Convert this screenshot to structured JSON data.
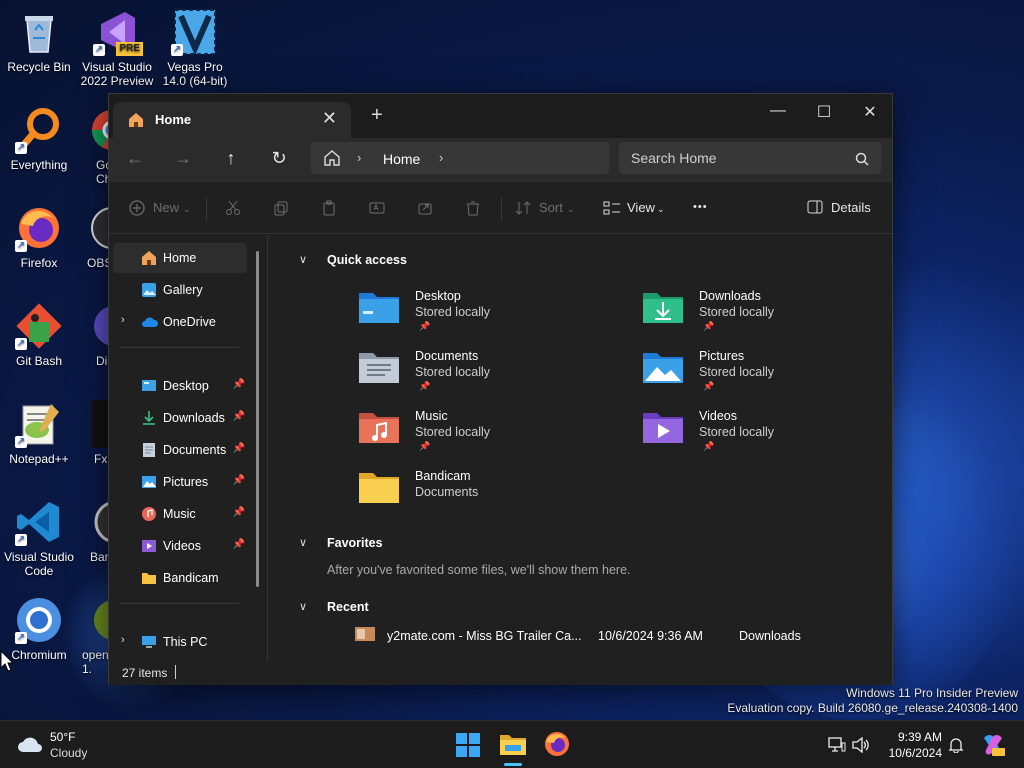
{
  "desktop": {
    "icons": [
      {
        "label": "Recycle Bin"
      },
      {
        "label": "Visual Studio 2022 Preview",
        "badge": "PRE"
      },
      {
        "label": "Vegas Pro 14.0 (64-bit)"
      },
      {
        "label": "Everything"
      },
      {
        "label": "Go Ch"
      },
      {
        "label": "Firefox"
      },
      {
        "label": "OBS"
      },
      {
        "label": "Git Bash"
      },
      {
        "label": "Di"
      },
      {
        "label": "Notepad++"
      },
      {
        "label": "Fx"
      },
      {
        "label": "Visual Studio Code"
      },
      {
        "label": "Ban"
      },
      {
        "label": "Chromium"
      },
      {
        "label": "open 1."
      }
    ]
  },
  "window": {
    "tab_title": "Home",
    "tab_close": "✕",
    "tab_add": "+",
    "minimize": "—",
    "maximize": "☐",
    "close": "✕"
  },
  "nav": {
    "back": "←",
    "forward": "→",
    "up": "↑",
    "refresh": "↻",
    "crumb": "Home",
    "crumb_sep": "›",
    "search_placeholder": "Search Home"
  },
  "toolbar": {
    "new_label": "New",
    "sort_label": "Sort",
    "view_label": "View",
    "more_label": "•••",
    "details_label": "Details"
  },
  "sidebar": {
    "items": [
      {
        "label": "Home"
      },
      {
        "label": "Gallery"
      },
      {
        "label": "OneDrive"
      },
      {
        "label": "Desktop"
      },
      {
        "label": "Downloads"
      },
      {
        "label": "Documents"
      },
      {
        "label": "Pictures"
      },
      {
        "label": "Music"
      },
      {
        "label": "Videos"
      },
      {
        "label": "Bandicam"
      },
      {
        "label": "This PC"
      }
    ]
  },
  "content": {
    "quick_access_title": "Quick access",
    "quick_access": [
      {
        "name": "Desktop",
        "sub": "Stored locally"
      },
      {
        "name": "Downloads",
        "sub": "Stored locally"
      },
      {
        "name": "Documents",
        "sub": "Stored locally"
      },
      {
        "name": "Pictures",
        "sub": "Stored locally"
      },
      {
        "name": "Music",
        "sub": "Stored locally"
      },
      {
        "name": "Videos",
        "sub": "Stored locally"
      },
      {
        "name": "Bandicam",
        "sub": "Documents"
      }
    ],
    "favorites_title": "Favorites",
    "favorites_empty": "After you've favorited some files, we'll show them here.",
    "recent_title": "Recent",
    "recent": [
      {
        "name": "y2mate.com - Miss BG Trailer Ca...",
        "date": "10/6/2024 9:36 AM",
        "location": "Downloads"
      }
    ]
  },
  "status": {
    "items_count": "27 items"
  },
  "watermark": {
    "line1": "Windows 11 Pro Insider Preview",
    "line2": "Evaluation copy. Build 26080.ge_release.240308-1400"
  },
  "taskbar": {
    "temp": "50°F",
    "condition": "Cloudy",
    "time": "9:39 AM",
    "date": "10/6/2024"
  },
  "colors": {
    "window_bg": "#202020",
    "navbar_bg": "#2b2b2b",
    "accent": "#4cc2ff",
    "folder_yellow": "#f5c242"
  }
}
